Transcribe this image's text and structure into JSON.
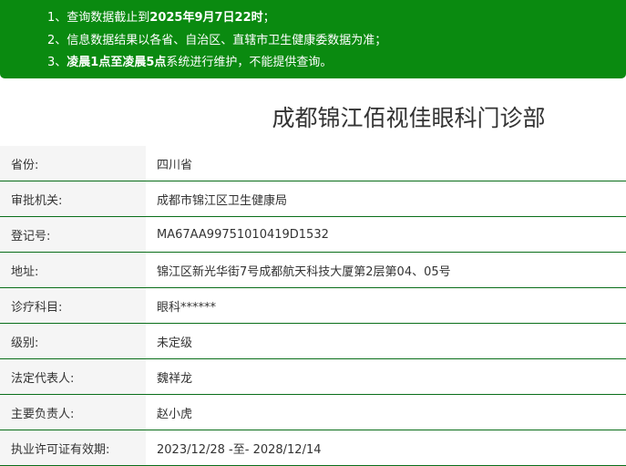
{
  "notice": {
    "line1_prefix": "1、查询数据截止到",
    "line1_bold": "2025年9月7日22时",
    "line1_suffix": "；",
    "line2": "2、信息数据结果以各省、自治区、直辖市卫生健康委数据为准；",
    "line3_prefix": "3、",
    "line3_bold": "凌晨1点至凌晨5点",
    "line3_suffix": "系统进行维护，不能提供查询。"
  },
  "org_name": "成都锦江佰视佳眼科门诊部",
  "rows": [
    {
      "label": "省份:",
      "value": "四川省"
    },
    {
      "label": "审批机关:",
      "value": "成都市锦江区卫生健康局"
    },
    {
      "label": "登记号:",
      "value": "MA67AA99751010419D1532"
    },
    {
      "label": "地址:",
      "value": "锦江区新光华街7号成都航天科技大厦第2层第04、05号"
    },
    {
      "label": "诊疗科目:",
      "value": "眼科******"
    },
    {
      "label": "级别:",
      "value": "未定级"
    },
    {
      "label": "法定代表人:",
      "value": "魏祥龙"
    },
    {
      "label": "主要负责人:",
      "value": "赵小虎"
    },
    {
      "label": "执业许可证有效期:",
      "value": "2023/12/28 -至- 2028/12/14"
    }
  ]
}
